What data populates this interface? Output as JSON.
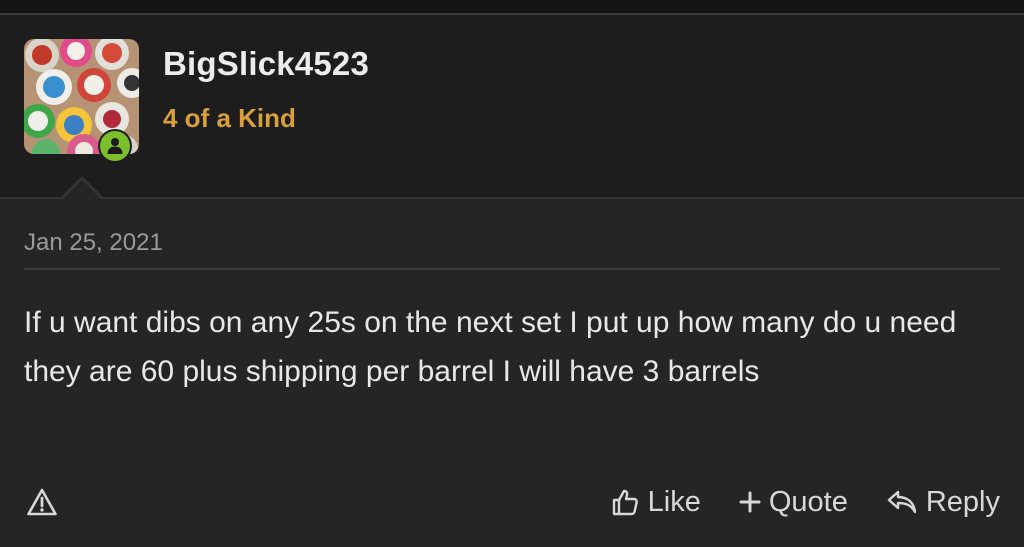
{
  "user": {
    "username": "BigSlick4523",
    "rank": "4 of a Kind",
    "avatar_icon": "poker-chips-avatar",
    "online_status_icon": "online-user-icon",
    "online_color": "#7bbf2a",
    "rank_color": "#d9a13a"
  },
  "post": {
    "date": "Jan 25, 2021",
    "text": "If u want dibs on any 25s on the next set I put up how many do u need they are 60 plus shipping per barrel I will have 3 barrels"
  },
  "actions": {
    "report_icon": "warning-triangle-icon",
    "like_label": "Like",
    "like_icon": "thumbs-up-icon",
    "quote_label": "Quote",
    "quote_icon": "plus-icon",
    "reply_label": "Reply",
    "reply_icon": "reply-arrow-icon"
  }
}
